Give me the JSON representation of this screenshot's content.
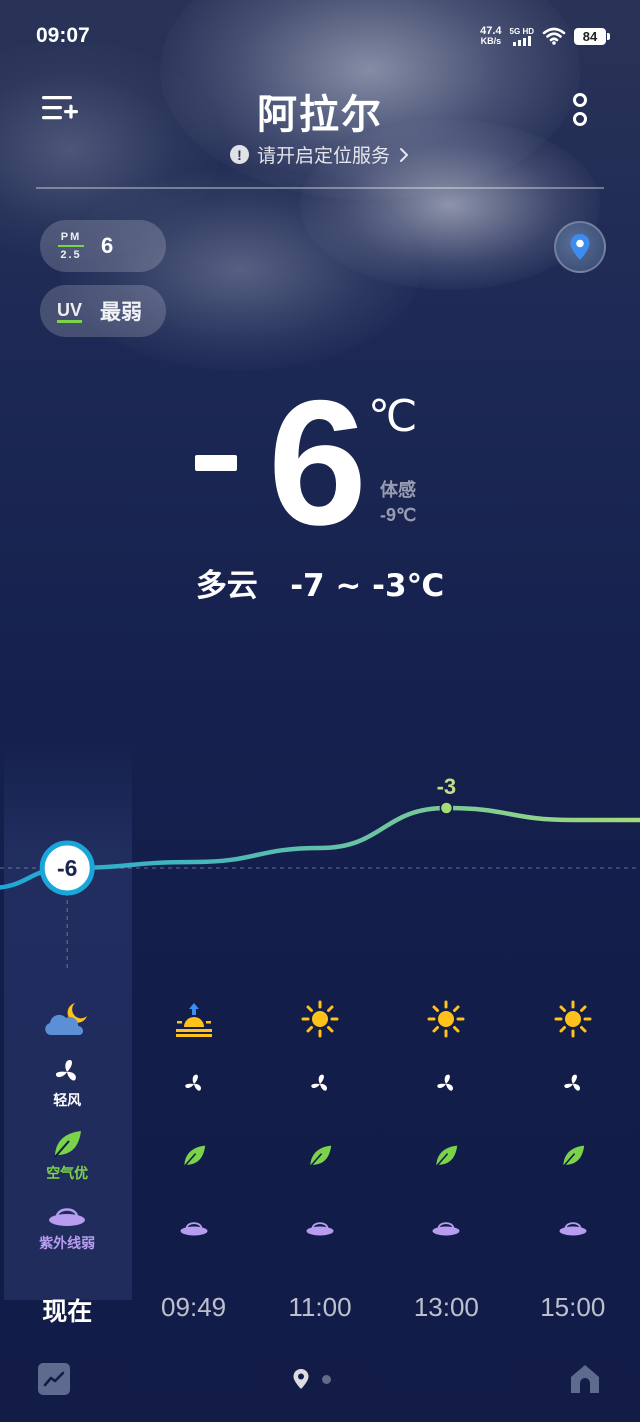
{
  "status_bar": {
    "time": "09:07",
    "net_speed": "47.4",
    "net_unit": "KB/s",
    "network_type": "5G HD",
    "battery": "84"
  },
  "header": {
    "city": "阿拉尔",
    "location_tip": "请开启定位服务",
    "info_icon": "!"
  },
  "air": {
    "pm_label_top": "PM",
    "pm_label_bottom": "2.5",
    "pm_value": "6",
    "uv_label": "UV",
    "uv_value": "最弱"
  },
  "current": {
    "temperature": "6",
    "unit": "℃",
    "feels_label": "体感",
    "feels_value": "-9℃",
    "condition_text": "多云   -7 ~ -3℃"
  },
  "chart_data": {
    "type": "line",
    "x": [
      "现在",
      "09:49",
      "11:00",
      "13:00",
      "15:00"
    ],
    "series": [
      {
        "values": [
          -6,
          -5.7,
          -5,
          -3,
          -3.6
        ]
      }
    ],
    "labels": [
      {
        "index": 0,
        "text": "-6"
      },
      {
        "index": 3,
        "text": "-3"
      }
    ],
    "colors": {
      "start": "#1aa6d9",
      "end": "#a6db7a"
    }
  },
  "hours": [
    {
      "time": "现在",
      "weather_icon": "cloudy-night-icon",
      "wind_label": "轻风",
      "aqi_label": "空气优",
      "uv_label": "紫外线弱"
    },
    {
      "time": "09:49",
      "weather_icon": "sunrise-icon"
    },
    {
      "time": "11:00",
      "weather_icon": "sun-icon"
    },
    {
      "time": "13:00",
      "weather_icon": "sun-icon"
    },
    {
      "time": "15:00",
      "weather_icon": "sun-icon"
    }
  ],
  "colors": {
    "accent_green": "#7bd34a",
    "uv_purple": "#b79cf0",
    "sun_yellow": "#ffc21a"
  }
}
